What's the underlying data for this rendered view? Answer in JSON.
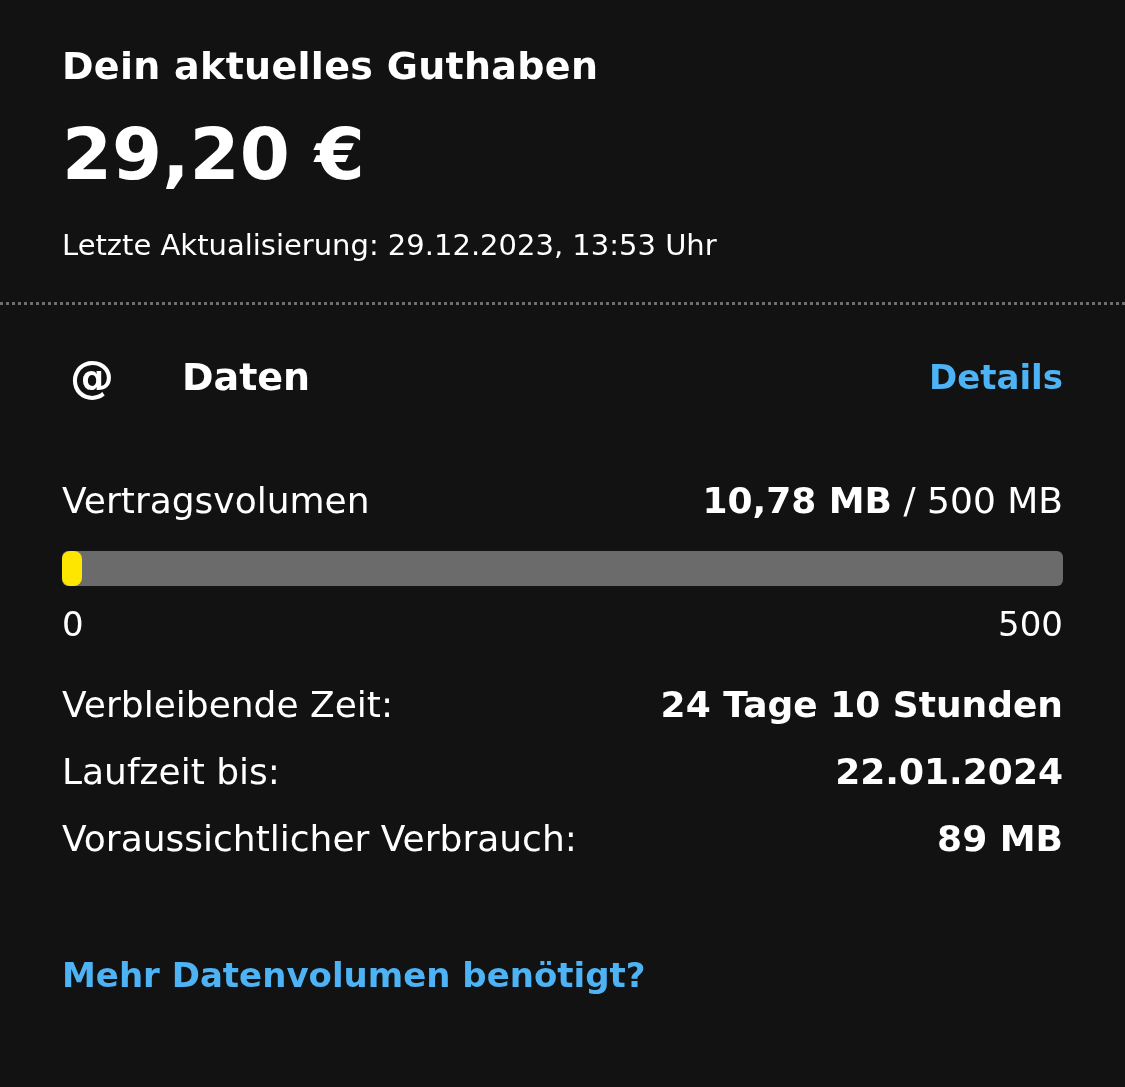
{
  "balance": {
    "title": "Dein aktuelles Guthaben",
    "amount": "29,20 €",
    "updated": "Letzte Aktualisierung: 29.12.2023, 13:53 Uhr"
  },
  "data": {
    "icon": "@",
    "title": "Daten",
    "details_link": "Details",
    "volume": {
      "label": "Vertragsvolumen",
      "reading": "**10,78 MB** / 500 MB",
      "level": 0.02,
      "min": "0",
      "max": "500"
    },
    "rows": [
      {
        "label": "Verbleibende Zeit:",
        "value": "24 Tage 10 Stunden"
      },
      {
        "label": "Laufzeit bis:",
        "value": "22.01.2024"
      },
      {
        "label": "Voraussichtlicher Verbrauch:",
        "value": "89 MB"
      }
    ],
    "more_link": "Mehr Datenvolumen benötigt?"
  }
}
